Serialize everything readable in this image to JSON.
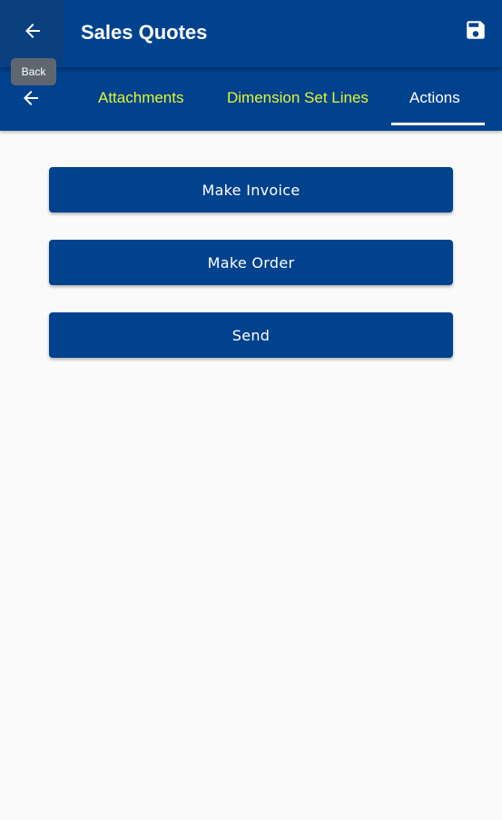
{
  "header": {
    "title": "Sales Quotes",
    "back_icon": "arrow-left-icon",
    "save_icon": "floppy-disk-icon"
  },
  "tooltip": {
    "text": "Back"
  },
  "tabs": {
    "back_icon": "arrow-left-icon",
    "items": [
      {
        "label": "Attachments",
        "active": false
      },
      {
        "label": "Dimension Set Lines",
        "active": false
      },
      {
        "label": "Actions",
        "active": true
      }
    ]
  },
  "actions": {
    "make_invoice": "Make Invoice",
    "make_order": "Make Order",
    "send": "Send"
  },
  "colors": {
    "primary": "#00428e",
    "inactive_tab": "#e2f533",
    "active_tab": "#ffffff",
    "background": "#fafafa",
    "tooltip_bg": "#5e6770"
  }
}
